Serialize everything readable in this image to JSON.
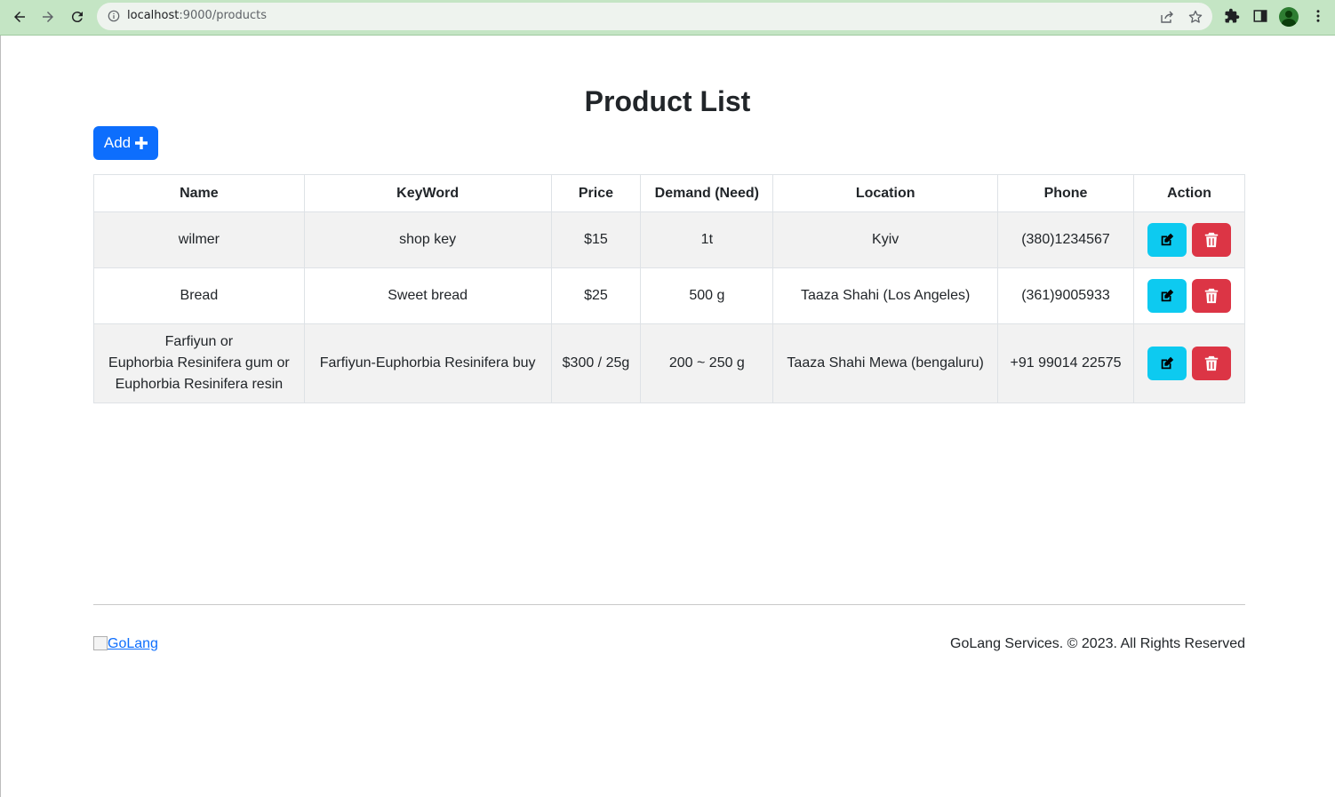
{
  "browser": {
    "url_host": "localhost",
    "url_rest": ":9000/products"
  },
  "page": {
    "title": "Product List",
    "add_label": "Add"
  },
  "table": {
    "headers": [
      "Name",
      "KeyWord",
      "Price",
      "Demand (Need)",
      "Location",
      "Phone",
      "Action"
    ],
    "rows": [
      {
        "name_lines": [
          "wilmer"
        ],
        "keyword": "shop key",
        "price": "$15",
        "demand": "1t",
        "location": "Kyiv",
        "phone": "(380)1234567"
      },
      {
        "name_lines": [
          "Bread"
        ],
        "keyword": "Sweet bread",
        "price": "$25",
        "demand": "500 g",
        "location": "Taaza Shahi (Los Angeles)",
        "phone": "(361)9005933"
      },
      {
        "name_lines": [
          "Farfiyun or",
          "Euphorbia Resinifera gum or",
          "Euphorbia Resinifera resin"
        ],
        "keyword": "Farfiyun-Euphorbia Resinifera buy",
        "price": "$300 / 25g",
        "demand": "200 ~ 250 g",
        "location": "Taaza Shahi Mewa (bengaluru)",
        "phone": "+91 99014 22575"
      }
    ]
  },
  "footer": {
    "logo_alt": "GoLang",
    "copyright": "GoLang Services. © 2023. All Rights Reserved"
  },
  "colors": {
    "primary": "#0d6efd",
    "info": "#0dcaf0",
    "danger": "#dc3545",
    "chrome": "#c4e5c4"
  },
  "icons": {
    "add": "plus-icon",
    "edit": "edit-icon",
    "delete": "trash-icon"
  }
}
